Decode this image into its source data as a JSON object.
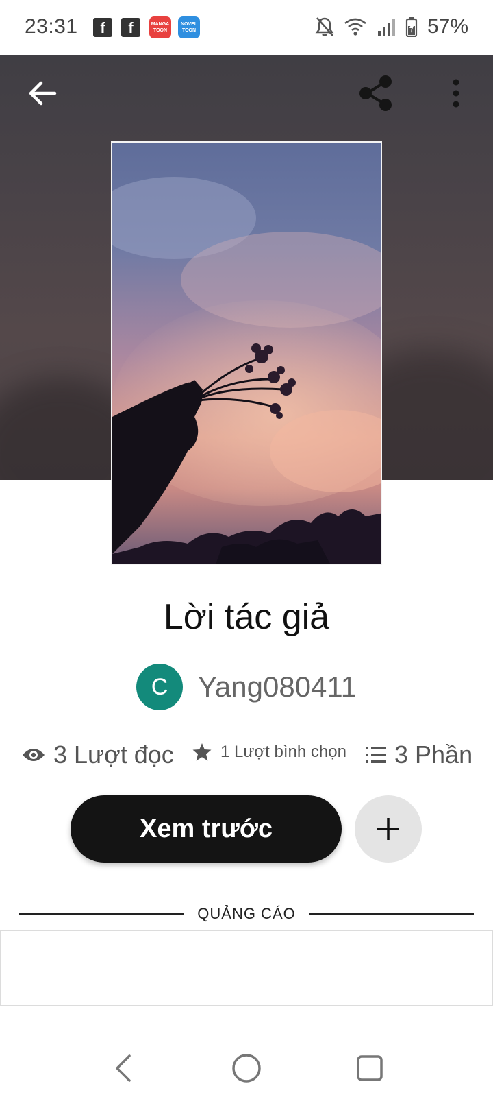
{
  "status_bar": {
    "time": "23:31",
    "app_icons": [
      "facebook-icon",
      "facebook-icon",
      "mangatoon-icon",
      "noveltoon-icon"
    ],
    "mangatoon_label": "MANGA TOON",
    "noveltoon_label": "NOVEL TOON",
    "battery": "57%"
  },
  "header": {
    "back_icon": "arrow-left-icon",
    "share_icon": "share-icon",
    "more_icon": "more-vertical-icon"
  },
  "story": {
    "title": "Lời tác giả",
    "author_initial": "C",
    "author_name": "Yang080411",
    "avatar_color": "#138a7b"
  },
  "stats": {
    "views": "3 Lượt đọc",
    "votes": "1 Lượt bình chọn",
    "parts": "3 Phần"
  },
  "actions": {
    "read_label": "Xem trước",
    "add_icon": "plus-icon"
  },
  "ad": {
    "label": "QUẢNG CÁO"
  },
  "nav": {
    "back": "nav-back-icon",
    "home": "nav-home-icon",
    "recents": "nav-recents-icon"
  }
}
